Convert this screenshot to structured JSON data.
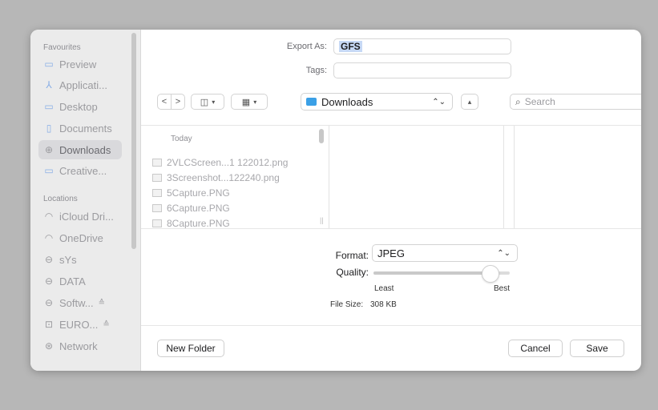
{
  "sidebar": {
    "favourites_header": "Favourites",
    "favourites": [
      {
        "label": "Preview",
        "icon": "folder-icon"
      },
      {
        "label": "Applicati...",
        "icon": "applications-icon"
      },
      {
        "label": "Desktop",
        "icon": "desktop-icon"
      },
      {
        "label": "Documents",
        "icon": "document-icon"
      },
      {
        "label": "Downloads",
        "icon": "download-icon",
        "selected": true
      },
      {
        "label": "Creative...",
        "icon": "folder-icon"
      }
    ],
    "locations_header": "Locations",
    "locations": [
      {
        "label": "iCloud Dri...",
        "icon": "cloud-icon"
      },
      {
        "label": "OneDrive",
        "icon": "cloud-icon"
      },
      {
        "label": "sYs",
        "icon": "drive-icon"
      },
      {
        "label": "DATA",
        "icon": "drive-icon"
      },
      {
        "label": "Softw...",
        "icon": "drive-icon",
        "eject": "≙"
      },
      {
        "label": "EURO...",
        "icon": "disk-image-icon",
        "eject": "≙"
      },
      {
        "label": "Network",
        "icon": "network-icon"
      }
    ]
  },
  "export": {
    "export_as_label": "Export As:",
    "export_as_value": "GFS",
    "tags_label": "Tags:",
    "tags_value": ""
  },
  "toolbar": {
    "back_glyph": "<",
    "forward_glyph": ">",
    "location": "Downloads",
    "search_placeholder": "Search"
  },
  "browser": {
    "column_header": "Today",
    "files": [
      {
        "name": "2VLCScreen...1 122012.png"
      },
      {
        "name": "3Screenshot...122240.png"
      },
      {
        "name": "5Capture.PNG"
      },
      {
        "name": "6Capture.PNG"
      },
      {
        "name": "8Capture.PNG"
      }
    ]
  },
  "options": {
    "format_label": "Format:",
    "format_value": "JPEG",
    "quality_label": "Quality:",
    "quality_fraction": 0.85,
    "quality_min_label": "Least",
    "quality_max_label": "Best",
    "file_size_label": "File Size:",
    "file_size_value": "308 KB"
  },
  "footer": {
    "new_folder_label": "New Folder",
    "cancel_label": "Cancel",
    "save_label": "Save"
  },
  "colors": {
    "accent": "#3ba0e6",
    "sidebar_icon": "#88aee6",
    "selected_bg": "#d9d9dc"
  }
}
